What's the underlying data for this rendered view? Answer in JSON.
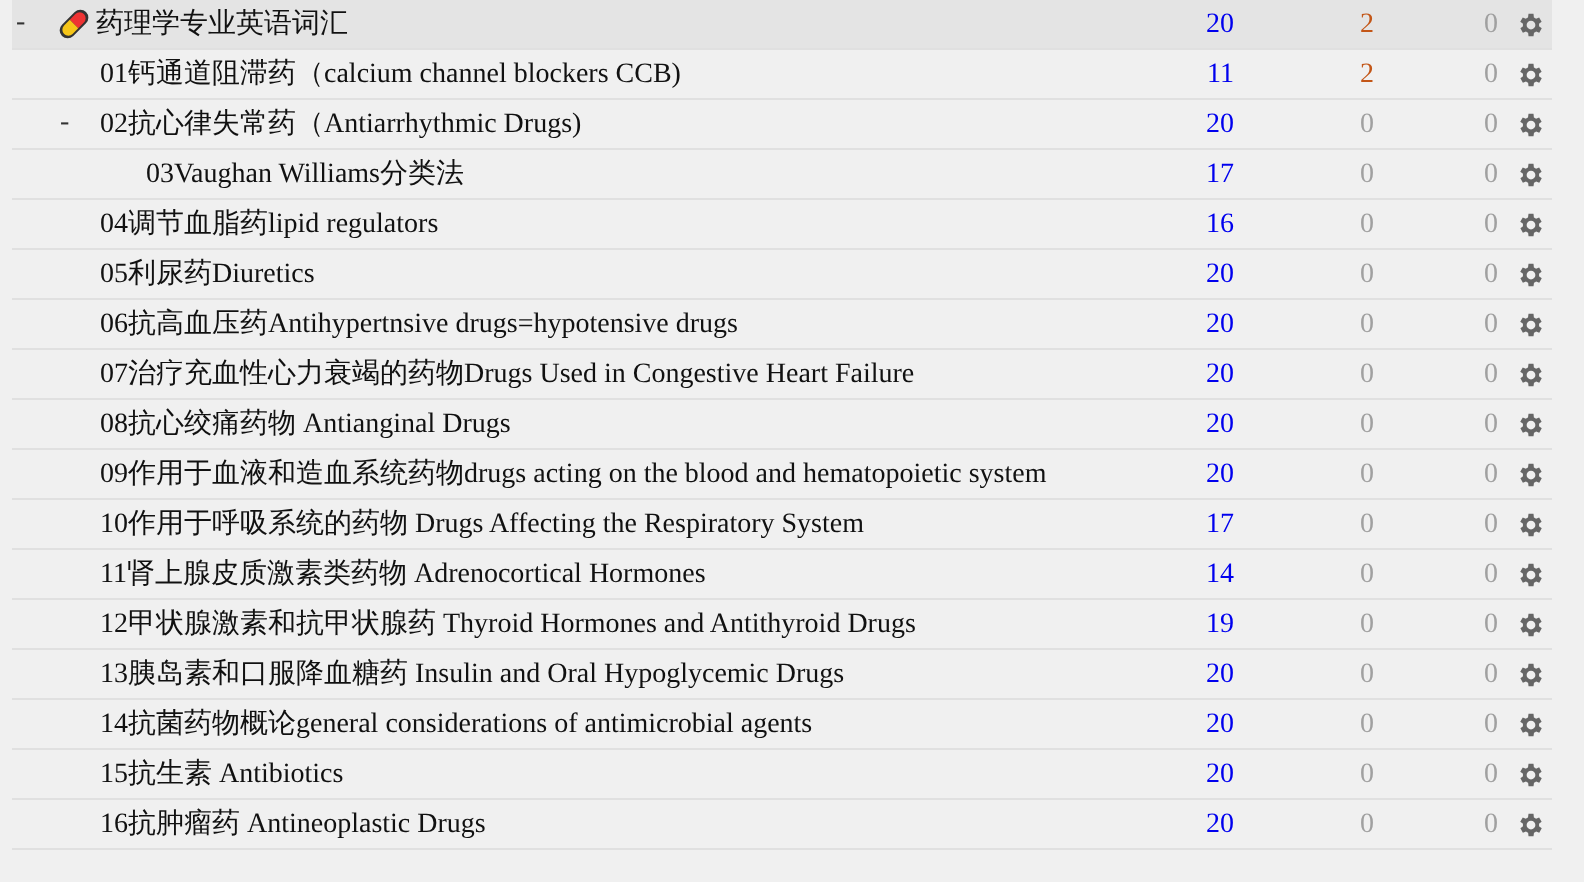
{
  "decks": [
    {
      "name": "药理学专业英语词汇",
      "selected": true,
      "expanded": true,
      "toggle": "-",
      "due": {
        "text": "20",
        "dim": false
      },
      "learn": {
        "text": "2",
        "dim": false
      },
      "new": {
        "text": "0",
        "dim": true
      },
      "children": [
        {
          "name": "01钙通道阻滞药（calcium channel blockers CCB)",
          "selected": false,
          "due": {
            "text": "11",
            "dim": false
          },
          "learn": {
            "text": "2",
            "dim": false
          },
          "new": {
            "text": "0",
            "dim": true
          }
        },
        {
          "name": "02抗心律失常药（Antiarrhythmic Drugs)",
          "selected": false,
          "expanded": true,
          "toggle": "-",
          "due": {
            "text": "20",
            "dim": false
          },
          "learn": {
            "text": "0",
            "dim": true
          },
          "new": {
            "text": "0",
            "dim": true
          },
          "children": [
            {
              "name": "03Vaughan Williams分类法",
              "selected": false,
              "due": {
                "text": "17",
                "dim": false
              },
              "learn": {
                "text": "0",
                "dim": true
              },
              "new": {
                "text": "0",
                "dim": true
              }
            }
          ]
        },
        {
          "name": "04调节血脂药lipid regulators",
          "selected": false,
          "due": {
            "text": "16",
            "dim": false
          },
          "learn": {
            "text": "0",
            "dim": true
          },
          "new": {
            "text": "0",
            "dim": true
          }
        },
        {
          "name": "05利尿药Diuretics",
          "selected": false,
          "due": {
            "text": "20",
            "dim": false
          },
          "learn": {
            "text": "0",
            "dim": true
          },
          "new": {
            "text": "0",
            "dim": true
          }
        },
        {
          "name": "06抗高血压药Antihypertnsive drugs=hypotensive drugs",
          "selected": false,
          "due": {
            "text": "20",
            "dim": false
          },
          "learn": {
            "text": "0",
            "dim": true
          },
          "new": {
            "text": "0",
            "dim": true
          }
        },
        {
          "name": "07治疗充血性心力衰竭的药物Drugs Used in Congestive Heart Failure",
          "selected": false,
          "due": {
            "text": "20",
            "dim": false
          },
          "learn": {
            "text": "0",
            "dim": true
          },
          "new": {
            "text": "0",
            "dim": true
          }
        },
        {
          "name": "08抗心绞痛药物 Antianginal Drugs",
          "selected": false,
          "due": {
            "text": "20",
            "dim": false
          },
          "learn": {
            "text": "0",
            "dim": true
          },
          "new": {
            "text": "0",
            "dim": true
          }
        },
        {
          "name": "09作用于血液和造血系统药物drugs acting on the blood and hematopoietic system",
          "selected": false,
          "due": {
            "text": "20",
            "dim": false
          },
          "learn": {
            "text": "0",
            "dim": true
          },
          "new": {
            "text": "0",
            "dim": true
          }
        },
        {
          "name": "10作用于呼吸系统的药物 Drugs Affecting the Respiratory System",
          "selected": false,
          "due": {
            "text": "17",
            "dim": false
          },
          "learn": {
            "text": "0",
            "dim": true
          },
          "new": {
            "text": "0",
            "dim": true
          }
        },
        {
          "name": "11肾上腺皮质激素类药物 Adrenocortical Hormones",
          "selected": false,
          "due": {
            "text": "14",
            "dim": false
          },
          "learn": {
            "text": "0",
            "dim": true
          },
          "new": {
            "text": "0",
            "dim": true
          }
        },
        {
          "name": "12甲状腺激素和抗甲状腺药 Thyroid Hormones and Antithyroid Drugs",
          "selected": false,
          "due": {
            "text": "19",
            "dim": false
          },
          "learn": {
            "text": "0",
            "dim": true
          },
          "new": {
            "text": "0",
            "dim": true
          }
        },
        {
          "name": "13胰岛素和口服降血糖药 Insulin and Oral Hypoglycemic Drugs",
          "selected": false,
          "due": {
            "text": "20",
            "dim": false
          },
          "learn": {
            "text": "0",
            "dim": true
          },
          "new": {
            "text": "0",
            "dim": true
          }
        },
        {
          "name": "14抗菌药物概论general considerations of antimicrobial agents",
          "selected": false,
          "due": {
            "text": "20",
            "dim": false
          },
          "learn": {
            "text": "0",
            "dim": true
          },
          "new": {
            "text": "0",
            "dim": true
          }
        },
        {
          "name": "15抗生素 Antibiotics",
          "selected": false,
          "due": {
            "text": "20",
            "dim": false
          },
          "learn": {
            "text": "0",
            "dim": true
          },
          "new": {
            "text": "0",
            "dim": true
          }
        },
        {
          "name": "16抗肿瘤药 Antineoplastic Drugs",
          "selected": false,
          "due": {
            "text": "20",
            "dim": false
          },
          "learn": {
            "text": "0",
            "dim": true
          },
          "new": {
            "text": "0",
            "dim": true
          }
        }
      ]
    }
  ]
}
